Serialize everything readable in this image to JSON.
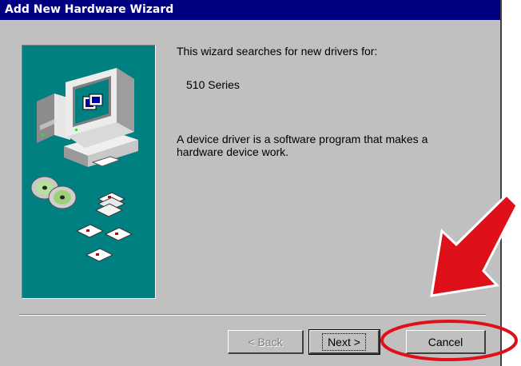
{
  "window": {
    "title": "Add New Hardware Wizard"
  },
  "content": {
    "intro": "This wizard searches for new drivers for:",
    "device": "510 Series",
    "description": "A device driver is a software program that makes a hardware device work."
  },
  "buttons": {
    "back": "< Back",
    "next": "Next >",
    "cancel": "Cancel"
  },
  "colors": {
    "titlebar": "#000080",
    "dialog": "#c0c0c0",
    "art_background": "#008080",
    "annotation": "#e0101a"
  },
  "icons": {
    "art": "computer-disks-illustration",
    "annotation": "red-arrow-pointer"
  }
}
